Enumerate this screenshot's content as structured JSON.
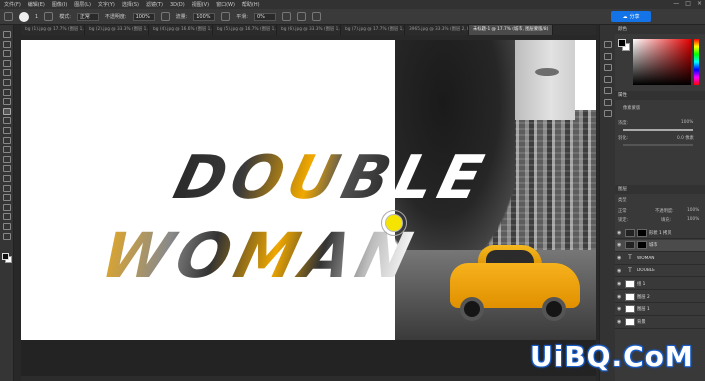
{
  "menubar": {
    "items": [
      "文件(F)",
      "编辑(E)",
      "图像(I)",
      "图层(L)",
      "文字(Y)",
      "选择(S)",
      "滤镜(T)",
      "3D(D)",
      "视图(V)",
      "窗口(W)",
      "帮助(H)"
    ],
    "window_controls": [
      "—",
      "□",
      "×"
    ]
  },
  "options": {
    "brush_size": "1",
    "mode_label": "模式:",
    "mode_value": "正常",
    "opacity_label": "不透明度:",
    "opacity_value": "100%",
    "flow_label": "流量:",
    "flow_value": "100%",
    "smooth_label": "平滑:",
    "smooth_value": "0%",
    "share_label": "分享"
  },
  "tabs": [
    {
      "label": "bg (1).jpg @ 17.7% (图层 1, RGB/8)",
      "active": false
    },
    {
      "label": "bg (2).jpg @ 33.3% (图层 1, RGB/8)",
      "active": false
    },
    {
      "label": "bg (4).jpg @ 16.6% (图层 1, RGB/8)",
      "active": false
    },
    {
      "label": "bg (5).jpg @ 16.7% (图层 1, RGB/8)",
      "active": false
    },
    {
      "label": "bg (6).jpg @ 33.3% (图层 1, RGB/8)",
      "active": false
    },
    {
      "label": "bg (7).jpg @ 17.7% (图层 1, RGB/8)",
      "active": false
    },
    {
      "label": "3965.jpg @ 33.3% (图层 2, RGB/8)",
      "active": false
    },
    {
      "label": "未标题-1 @ 17.7% (城市, 图层蒙版/8)",
      "active": true
    }
  ],
  "artwork": {
    "line1_dark": "DOUB",
    "line1_light": "LE",
    "line2": "WOMAN"
  },
  "panels": {
    "color_title": "颜色",
    "properties_title": "属性",
    "prop_mask_label": "像素蒙版",
    "prop_density_label": "浓度:",
    "prop_density_value": "100%",
    "prop_feather_label": "羽化:",
    "prop_feather_value": "0.0 像素",
    "layers_title": "图层",
    "kind_label": "类型",
    "blend_label": "正常",
    "opacity_label": "不透明度:",
    "opacity_value": "100%",
    "lock_label": "锁定:",
    "fill_label": "填充:",
    "fill_value": "100%",
    "layers": [
      {
        "name": "形状 1 拷贝",
        "thumb": "dark",
        "selected": false
      },
      {
        "name": "城市",
        "thumb": "dark",
        "selected": true
      },
      {
        "name": "WOMAN",
        "thumb": "t",
        "selected": false
      },
      {
        "name": "DOUBLE",
        "thumb": "t",
        "selected": false
      },
      {
        "name": "组 1",
        "thumb": "white",
        "selected": false
      },
      {
        "name": "图层 2",
        "thumb": "white",
        "selected": false
      },
      {
        "name": "图层 1",
        "thumb": "white",
        "selected": false
      },
      {
        "name": "背景",
        "thumb": "white",
        "selected": false
      }
    ]
  },
  "watermark": "UiBQ.CoM",
  "colors": {
    "share_button": "#1473e6",
    "taxi_yellow": "#f7b21c",
    "cursor_yellow": "#f5e400"
  }
}
